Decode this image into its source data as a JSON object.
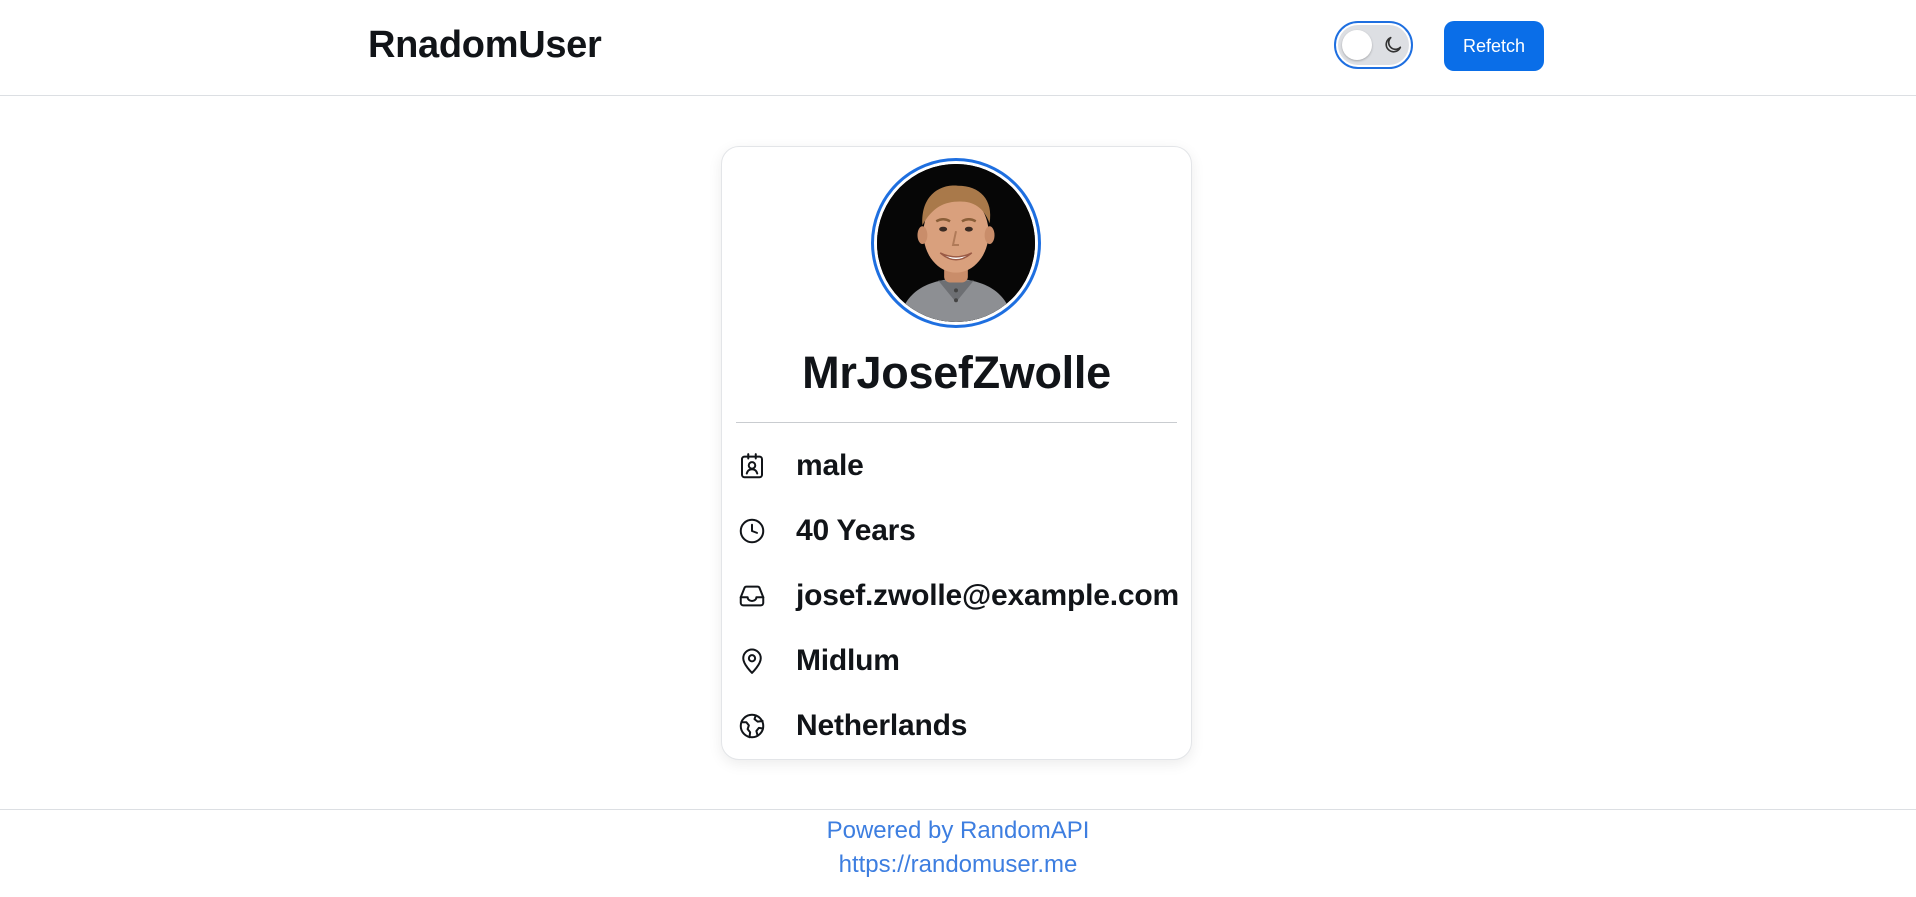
{
  "header": {
    "brand": "RnadomUser",
    "theme_toggle_state": "light",
    "refetch_label": "Refetch",
    "accent_color": "#0a6ee8"
  },
  "profile": {
    "avatar_icon": "user-photo",
    "name": "MrJosefZwolle",
    "details": [
      {
        "icon": "id-badge-icon",
        "value": "male"
      },
      {
        "icon": "clock-icon",
        "value": "40 Years"
      },
      {
        "icon": "inbox-icon",
        "value": "josef.zwolle@example.com"
      },
      {
        "icon": "map-pin-icon",
        "value": "Midlum"
      },
      {
        "icon": "globe-icon",
        "value": "Netherlands"
      }
    ]
  },
  "footer": {
    "powered_by": "Powered by RandomAPI",
    "link": "https://randomuser.me",
    "link_color": "#3d7ee0"
  }
}
